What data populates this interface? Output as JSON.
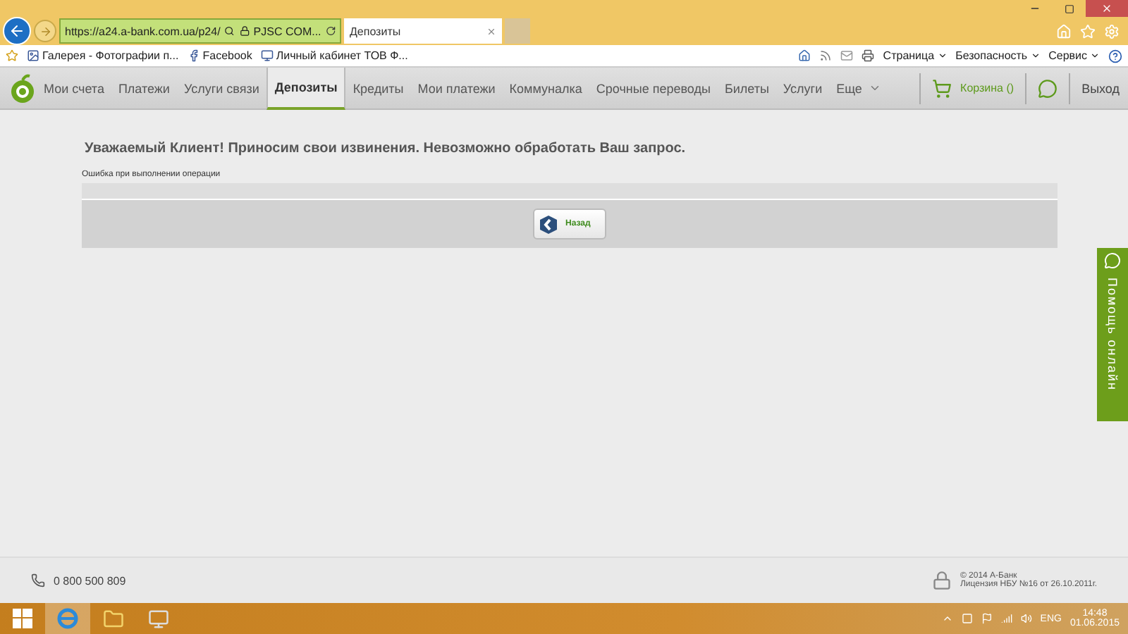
{
  "browser": {
    "address": "https://a24.a-bank.com.ua/p24/",
    "certificate": "PJSC COM...",
    "tabs": [
      {
        "title": "Депозиты",
        "selected": true
      }
    ],
    "favorites": [
      {
        "label": "Галерея - Фотографии п..."
      },
      {
        "label": "Facebook"
      },
      {
        "label": "Личный кабинет ТОВ Ф..."
      }
    ],
    "commands": [
      "Страница",
      "Безопасность",
      "Сервис"
    ]
  },
  "nav": {
    "items": [
      {
        "label": "Мои счета",
        "selected": false
      },
      {
        "label": "Платежи",
        "selected": false
      },
      {
        "label": "Услуги связи",
        "selected": false
      },
      {
        "label": "Депозиты",
        "selected": true
      },
      {
        "label": "Кредиты",
        "selected": false
      },
      {
        "label": "Мои платежи",
        "selected": false
      },
      {
        "label": "Коммуналка",
        "selected": false
      },
      {
        "label": "Срочные переводы",
        "selected": false
      },
      {
        "label": "Билеты",
        "selected": false
      },
      {
        "label": "Услуги",
        "selected": false
      },
      {
        "label": "Еще",
        "selected": false
      }
    ],
    "cart": "Корзина ()",
    "logout": "Выход"
  },
  "message": {
    "title": "Уважаемый Клиент! Приносим свои извинения. Невозможно обработать Ваш запрос.",
    "error": "Ошибка при выполнении операции",
    "back_button": "Назад"
  },
  "help_tab": "Помощь онлайн",
  "footer": {
    "phone": "0 800 500 809",
    "copyright": "© 2014 А-Банк",
    "license": "Лицензия НБУ №16 от 26.10.2011г."
  },
  "taskbar": {
    "language": "ENG",
    "time": "14:48",
    "date": "01.06.2015"
  }
}
